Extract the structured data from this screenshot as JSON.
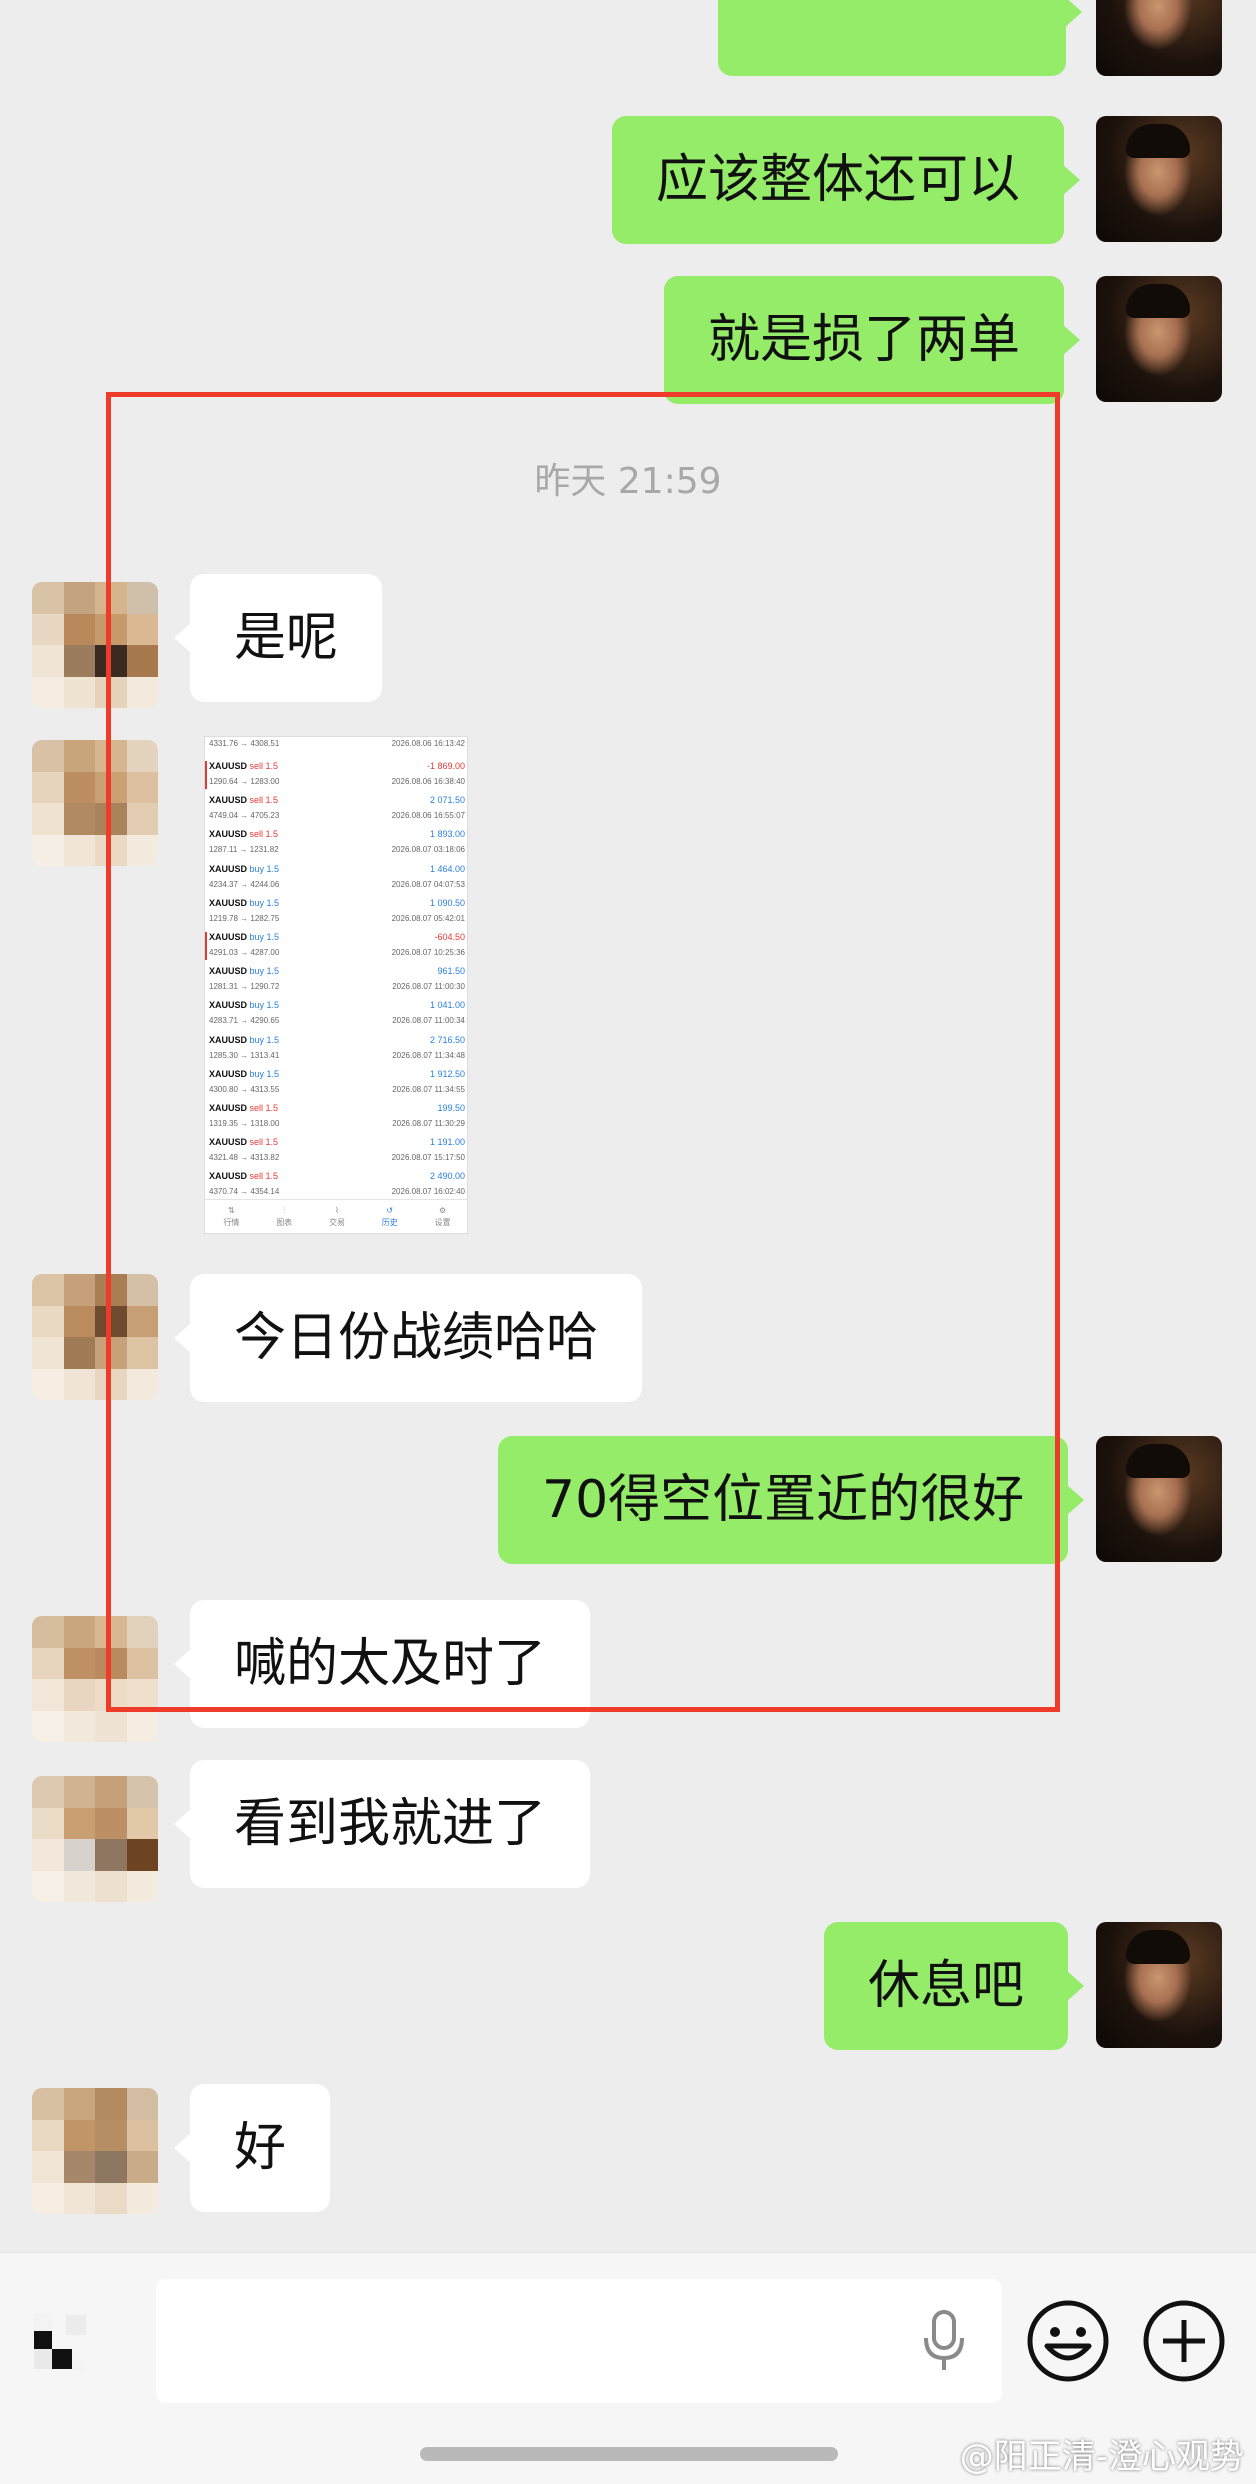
{
  "messages": {
    "m0": "",
    "m1": "应该整体还可以",
    "m2": "就是损了两单",
    "timestamp": "昨天 21:59",
    "m3": "是呢",
    "m5": "今日份战绩哈哈",
    "m6": "70得空位置近的很好",
    "m7": "喊的太及时了",
    "m8": "看到我就进了",
    "m9": "休息吧",
    "m10": "好"
  },
  "screenshot": {
    "header_row": {
      "px": "4331.76 → 4308.51",
      "dt": "2026.08.06 16:13:42"
    },
    "trades": [
      {
        "sym": "XAUUSD",
        "side": "sell",
        "lot": "1.5",
        "pnl": "-1 869.00",
        "px": "1290.64 → 1283.00",
        "dt": "2026.08.06 16:38:40",
        "color": "#e53935"
      },
      {
        "sym": "XAUUSD",
        "side": "sell",
        "lot": "1.5",
        "pnl": "2 071.50",
        "px": "4749.04 → 4705.23",
        "dt": "2026.08.06 16:55:07",
        "color": "#2a7fe0"
      },
      {
        "sym": "XAUUSD",
        "side": "sell",
        "lot": "1.5",
        "pnl": "1 893.00",
        "px": "1287.11 → 1231.82",
        "dt": "2026.08.07 03:18:06",
        "color": "#2a7fe0"
      },
      {
        "sym": "XAUUSD",
        "side": "buy",
        "lot": "1.5",
        "pnl": "1 464.00",
        "px": "4234.37 → 4244.06",
        "dt": "2026.08.07 04:07:53",
        "color": "#2a7fe0"
      },
      {
        "sym": "XAUUSD",
        "side": "buy",
        "lot": "1.5",
        "pnl": "1 090.50",
        "px": "1219.78 → 1282.75",
        "dt": "2026.08.07 05:42:01",
        "color": "#2a7fe0"
      },
      {
        "sym": "XAUUSD",
        "side": "buy",
        "lot": "1.5",
        "pnl": "-604.50",
        "px": "4291.03 → 4287.00",
        "dt": "2026.08.07 10:25:36",
        "color": "#e53935"
      },
      {
        "sym": "XAUUSD",
        "side": "buy",
        "lot": "1.5",
        "pnl": "961.50",
        "px": "1281.31 → 1290.72",
        "dt": "2026.08.07 11:00:30",
        "color": "#2a7fe0"
      },
      {
        "sym": "XAUUSD",
        "side": "buy",
        "lot": "1.5",
        "pnl": "1 041.00",
        "px": "4283.71 → 4290.65",
        "dt": "2026.08.07 11:00:34",
        "color": "#2a7fe0"
      },
      {
        "sym": "XAUUSD",
        "side": "buy",
        "lot": "1.5",
        "pnl": "2 716.50",
        "px": "1285.30 → 1313.41",
        "dt": "2026.08.07 11:34:48",
        "color": "#2a7fe0"
      },
      {
        "sym": "XAUUSD",
        "side": "buy",
        "lot": "1.5",
        "pnl": "1 912.50",
        "px": "4300.80 → 4313.55",
        "dt": "2026.08.07 11:34:55",
        "color": "#2a7fe0"
      },
      {
        "sym": "XAUUSD",
        "side": "sell",
        "lot": "1.5",
        "pnl": "199.50",
        "px": "1319.35 → 1318.00",
        "dt": "2026.08.07 11:30:29",
        "color": "#2a7fe0"
      },
      {
        "sym": "XAUUSD",
        "side": "sell",
        "lot": "1.5",
        "pnl": "1 191.00",
        "px": "4321.48 → 4313.82",
        "dt": "2026.08.07 15:17:50",
        "color": "#2a7fe0"
      },
      {
        "sym": "XAUUSD",
        "side": "sell",
        "lot": "1.5",
        "pnl": "2 490.00",
        "px": "4370.74 → 4354.14",
        "dt": "2026.08.07 16:02:40",
        "color": "#2a7fe0"
      }
    ],
    "tabs": [
      "行情",
      "图表",
      "交易",
      "历史",
      "设置"
    ]
  },
  "input": {
    "placeholder": ""
  },
  "icons": {
    "voice": "microphone-icon",
    "emoji": "emoji-icon",
    "more": "plus-circle-icon"
  },
  "watermark": "@阳正清-澄心观势",
  "colors": {
    "me_bubble": "#95ec69",
    "them_bubble": "#ffffff",
    "highlight_box": "#ee3b2a",
    "profit": "#2a7fe0",
    "loss": "#e53935"
  }
}
